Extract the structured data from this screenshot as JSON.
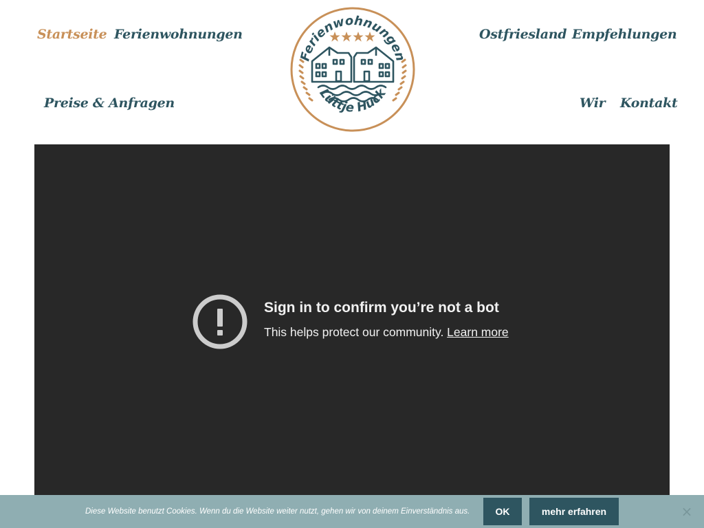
{
  "nav": {
    "startseite": "Startseite",
    "ferienwohnungen": "Ferienwohnungen",
    "ostfriesland": "Ostfriesland",
    "empfehlungen": "Empfehlungen",
    "preise": "Preise & Anfragen",
    "wir": "Wir",
    "kontakt": "Kontakt"
  },
  "logo": {
    "top_text": "Ferienwohnungen",
    "bottom_text": "Lüttje Huck",
    "stars": 4
  },
  "video": {
    "title": "Sign in to confirm you’re not a bot",
    "subtitle": "This helps protect our community.",
    "link": "Learn more",
    "icon": "warning-icon"
  },
  "cookie": {
    "text": "Diese Website benutzt Cookies. Wenn du die Website weiter nutzt, gehen wir von deinem Einverständnis aus.",
    "ok": "OK",
    "more": "mehr erfahren",
    "close": "×"
  },
  "colors": {
    "nav_text": "#2e5560",
    "nav_active": "#c89058",
    "video_bg": "#282828",
    "cookie_bg": "#8faeb2",
    "cookie_button": "#2e5560"
  }
}
